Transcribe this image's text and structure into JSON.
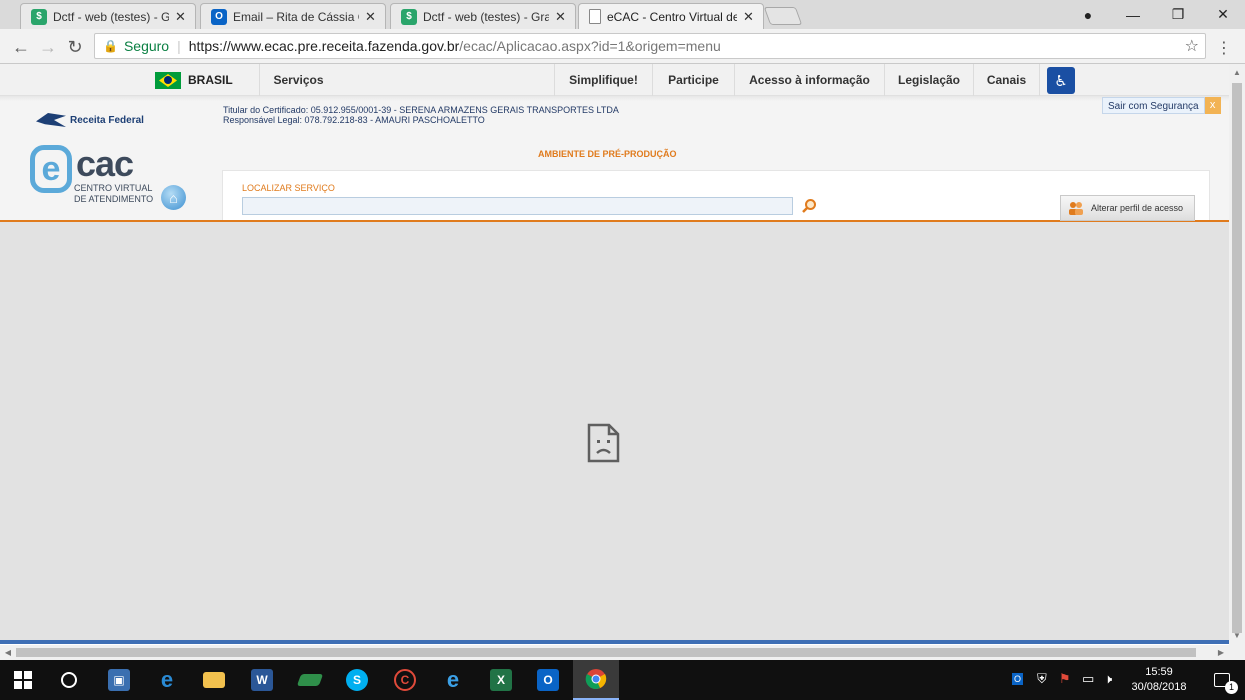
{
  "tabs": [
    {
      "title": "Dctf - web (testes) - Gran",
      "icon": "dctf-favicon",
      "active": false
    },
    {
      "title": "Email – Rita de Cássia Cal",
      "icon": "outlook-favicon",
      "active": false
    },
    {
      "title": "Dctf - web (testes) - Gran",
      "icon": "dctf-favicon",
      "active": false
    },
    {
      "title": "eCAC - Centro Virtual de",
      "icon": "page-favicon",
      "active": true
    }
  ],
  "address_bar": {
    "secure_label": "Seguro",
    "url_host": "https://www.ecac.pre.receita.fazenda.gov.br",
    "url_path": "/ecac/Aplicacao.aspx?id=1&origem=menu"
  },
  "gov_bar": {
    "brasil": "BRASIL",
    "servicos": "Serviços",
    "links": [
      "Simplifique!",
      "Participe",
      "Acesso à informação",
      "Legislação",
      "Canais"
    ]
  },
  "ecac": {
    "rf_logo_text": "Receita Federal",
    "logo_e": "e",
    "logo_cac": "cac",
    "logo_sub_1": "CENTRO VIRTUAL",
    "logo_sub_2": "DE ATENDIMENTO",
    "cert_holder": "Titular do Certificado: 05.912.955/0001-39 - SERENA ARMAZENS GERAIS TRANSPORTES LTDA",
    "legal_rep": "Responsável Legal: 078.792.218-83 - AMAURI PASCHOALETTO",
    "environment": "AMBIENTE DE PRÉ-PRODUÇÃO",
    "search_label": "LOCALIZAR SERVIÇO",
    "search_value": "",
    "profile_button": "Alterar perfil de acesso",
    "logout": "Sair com Segurança",
    "logout_close": "x"
  },
  "taskbar": {
    "time": "15:59",
    "date": "30/08/2018",
    "notification_count": "1",
    "apps": [
      "windows-start",
      "cortana",
      "remote-desktop",
      "edge",
      "file-explorer",
      "word",
      "app-green",
      "skype",
      "app-c",
      "internet-explorer",
      "excel",
      "outlook",
      "chrome"
    ]
  },
  "colors": {
    "accent_orange": "#e07b1d",
    "ecac_blue": "#5ba9d9",
    "gov_blue": "#1a4fa3",
    "secure_green": "#0b8043"
  }
}
